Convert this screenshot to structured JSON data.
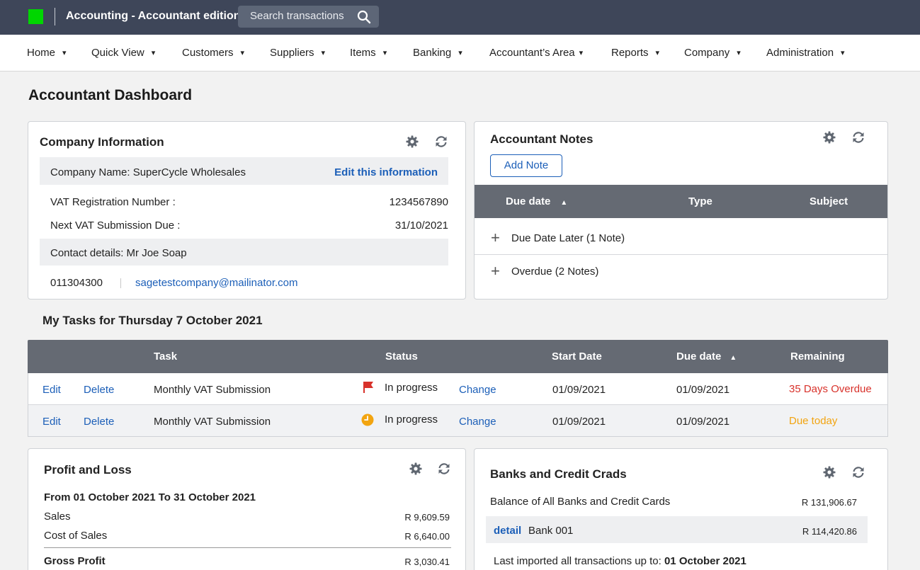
{
  "app": {
    "title": "Accounting - Accountant edition",
    "search_placeholder": "Search transactions",
    "brand_color": "#00d600",
    "topbar_color": "#3e4659"
  },
  "nav": {
    "items": [
      {
        "label": "Home",
        "caret": "▾"
      },
      {
        "label": "Quick View",
        "caret": "▾"
      },
      {
        "label": "Customers",
        "caret": "▾"
      },
      {
        "label": "Suppliers",
        "caret": "▾"
      },
      {
        "label": "Items",
        "caret": "▾"
      },
      {
        "label": "Banking",
        "caret": "▾"
      },
      {
        "label": "Accountant’s Area",
        "caret": "▾"
      },
      {
        "label": "Reports",
        "caret": "▾"
      },
      {
        "label": "Company",
        "caret": "▾"
      },
      {
        "label": "Administration",
        "caret": "▾"
      }
    ]
  },
  "page": {
    "title": "Accountant Dashboard"
  },
  "company_info": {
    "title": "Company Information",
    "company_name": "Company Name: SuperCycle Wholesales",
    "edit_link": "Edit this information",
    "vat_label": "VAT Registration Number :",
    "vat_value": "1234567890",
    "next_vat_label": "Next VAT Submission Due :",
    "next_vat_value": "31/10/2021",
    "contact": "Contact details: Mr Joe Soap",
    "phone": "011304300",
    "email": "sagetestcompany@mailinator.com"
  },
  "notes": {
    "title": "Accountant Notes",
    "add_button": "Add Note",
    "columns": [
      "Due date",
      "Type",
      "Subject"
    ],
    "sort_indicator": "▲",
    "groups": [
      {
        "expand": "+",
        "label": "Due Date Later (1 Note)"
      },
      {
        "expand": "+",
        "label": "Overdue (2 Notes)"
      }
    ]
  },
  "tasks": {
    "title": "My Tasks for Thursday 7 October 2021",
    "columns": [
      "Task",
      "Status",
      "Start Date",
      "Due date",
      "Remaining"
    ],
    "sort_indicator": "▲",
    "rows": [
      {
        "edit": "Edit",
        "delete": "Delete",
        "task": "Monthly VAT Submission",
        "status_icon": "flag-icon",
        "status": "In progress",
        "change": "Change",
        "start": "01/09/2021",
        "due": "01/09/2021",
        "remaining": "35 Days Overdue",
        "remaining_color": "#d8322b"
      },
      {
        "edit": "Edit",
        "delete": "Delete",
        "task": "Monthly VAT Submission",
        "status_icon": "clock-icon",
        "status": "In progress",
        "change": "Change",
        "start": "01/09/2021",
        "due": "01/09/2021",
        "remaining": "Due today",
        "remaining_color": "#f2a410"
      }
    ]
  },
  "profit_loss": {
    "title": "Profit and Loss",
    "period": "From 01 October 2021 To 31 October 2021",
    "sales_label": "Sales",
    "sales_value": "R 9,609.59",
    "cos_label": "Cost of Sales",
    "cos_value": "R 6,640.00",
    "gross_label": "Gross Profit",
    "gross_value": "R 3,030.41"
  },
  "banks": {
    "title": "Banks and Credit Crads",
    "balance_label": "Balance of All Banks and Credit Cards",
    "balance_value": "R 131,906.67",
    "detail_link": "detail",
    "bank_name": "Bank 001",
    "bank_value": "R 114,420.86",
    "import_label": "Last imported all transactions up to:",
    "import_date": "01 October 2021"
  }
}
